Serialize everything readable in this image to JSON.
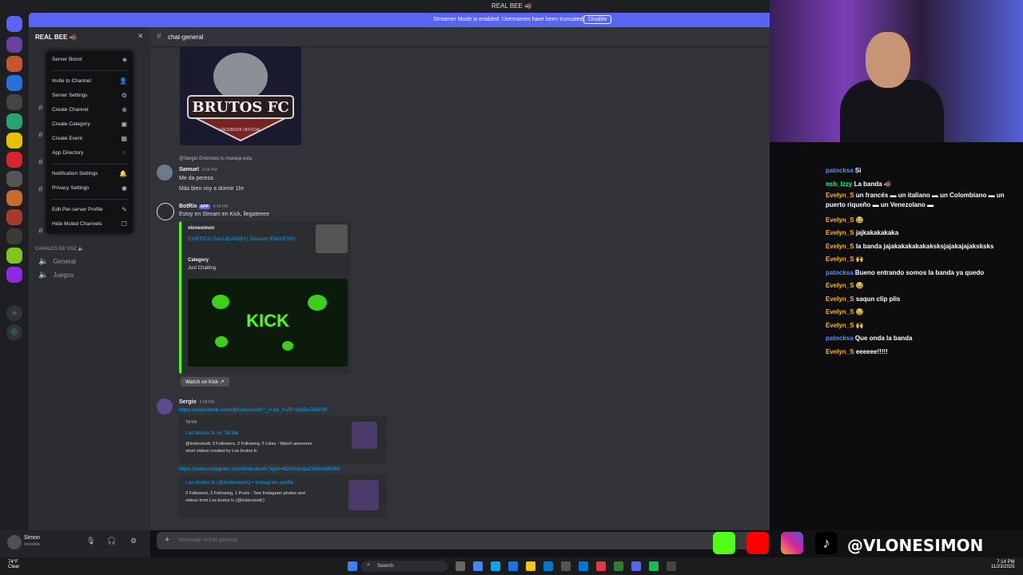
{
  "app": {
    "title": "REAL BEE 🐗"
  },
  "banner": {
    "text": "Streamer Mode is enabled. Usernames have been truncated.",
    "disable_label": "Disable"
  },
  "server": {
    "name": "REAL BEE 🐗"
  },
  "context_menu": {
    "items": [
      {
        "label": "Server Boost",
        "icon": "boost-icon"
      },
      {
        "label": "Invite to Channel",
        "icon": "add-person-icon"
      },
      {
        "label": "Server Settings",
        "icon": "gear-icon"
      },
      {
        "label": "Create Channel",
        "icon": "plus-circle-icon"
      },
      {
        "label": "Create Category",
        "icon": "folder-icon"
      },
      {
        "label": "Create Event",
        "icon": "calendar-icon"
      },
      {
        "label": "App Directory",
        "icon": "apps-icon"
      },
      {
        "label": "Notification Settings",
        "icon": "bell-icon"
      },
      {
        "label": "Privacy Settings",
        "icon": "shield-icon"
      },
      {
        "label": "Edit Per-server Profile",
        "icon": "pencil-icon"
      },
      {
        "label": "Hide Muted Channels",
        "icon": "checkbox-icon"
      }
    ]
  },
  "sidebar": {
    "voice_category": "CANALES DE VOZ 🔈",
    "voice_channels": [
      "General",
      "Juegos"
    ]
  },
  "user": {
    "name": "Simon",
    "status": "Invisible"
  },
  "chat": {
    "channel": "chat-general",
    "composer_placeholder": "Message #chat-general",
    "embed_logo_text": "BRUTOS FC",
    "embed_logo_sub": "FACEBOOK OFFICIAL",
    "reply_ref": "@Sergio Entonces tu maneja esta",
    "samuel": {
      "author": "Samuel",
      "time": "6:04 PM",
      "lines": [
        "Me da pereza",
        "Más bien voy a dormir 1hr"
      ]
    },
    "botrix": {
      "author": "BotRix",
      "tag": "APP",
      "time": "6:49 PM",
      "text": "Estoy en Stream en Kick, llegateeee",
      "embed_author": "vlonesimon",
      "embed_title": "CORTICO SALUDANDO | Discord (ENG/ESP)",
      "category_label": "Category",
      "category_value": "Just Chatting",
      "kick_text": "KICK",
      "watch_label": "Watch on Kick"
    },
    "sergio": {
      "author": "Sergio",
      "time": "6:58 PM",
      "tiktok_url": "https://www.tiktok.com/@losbrutosfc?_r=1&_t=ZP-91b5n7b6P30",
      "tiktok_provider": "TikTok",
      "tiktok_title": "Los brutos fc on TikTok",
      "tiktok_desc_1": "@losbrutosfc 3 Followers, 3 Following, 5 Likes - Watch awesome",
      "tiktok_desc_2": "short videos created by Los brutos fc",
      "ig_url": "https://www.instagram.com/losbrutosfc?igsh=bDRmbnpuOWxmMGMz",
      "ig_title": "Los brutos fc (@losbrutosfc) • Instagram profile",
      "ig_desc_1": "3 Followers, 3 Following, 1 Posts - See Instagram photos and",
      "ig_desc_2": "videos from Los brutos fc (@losbrutosfc)"
    }
  },
  "stream_chat": [
    {
      "user": "patocksa",
      "text": "Si",
      "color": "p"
    },
    {
      "user": "nsb_Izzy",
      "text": "La banda 🐗",
      "color": "g"
    },
    {
      "user": "Evelyn_S",
      "text": "un francés ▬ un italiano ▬ un Colombiano ▬ un puerto riqueño ▬ un Venezolano ▬",
      "color": "o"
    },
    {
      "user": "Evelyn_S",
      "text": "😂",
      "color": "o"
    },
    {
      "user": "Evelyn_S",
      "text": "jajkakakakaka",
      "color": "o"
    },
    {
      "user": "Evelyn_S",
      "text": "la banda jajakakakakakaksksjajakajajaksksks",
      "color": "o"
    },
    {
      "user": "Evelyn_S",
      "text": "🙌",
      "color": "o"
    },
    {
      "user": "patocksa",
      "text": "Bueno entrando somos la banda ya quedo",
      "color": "p"
    },
    {
      "user": "Evelyn_S",
      "text": "😂",
      "color": "o"
    },
    {
      "user": "Evelyn_S",
      "text": "saqun clip plis",
      "color": "o"
    },
    {
      "user": "Evelyn_S",
      "text": "😂",
      "color": "o"
    },
    {
      "user": "Evelyn_S",
      "text": "🙌",
      "color": "o"
    },
    {
      "user": "patocksa",
      "text": "Que onda la banda",
      "color": "p"
    },
    {
      "user": "Evelyn_S",
      "text": "eeeeee!!!!!",
      "color": "o"
    }
  ],
  "socials": {
    "handle": "@VLONESIMON"
  },
  "taskbar": {
    "weather": "74°F",
    "weather_sub": "Clear",
    "search": "Search",
    "time": "7:14 PM",
    "date": "11/23/2025"
  },
  "colors": {
    "accent": "#5865f2",
    "kick": "#53fc18",
    "link": "#00a8fc"
  }
}
